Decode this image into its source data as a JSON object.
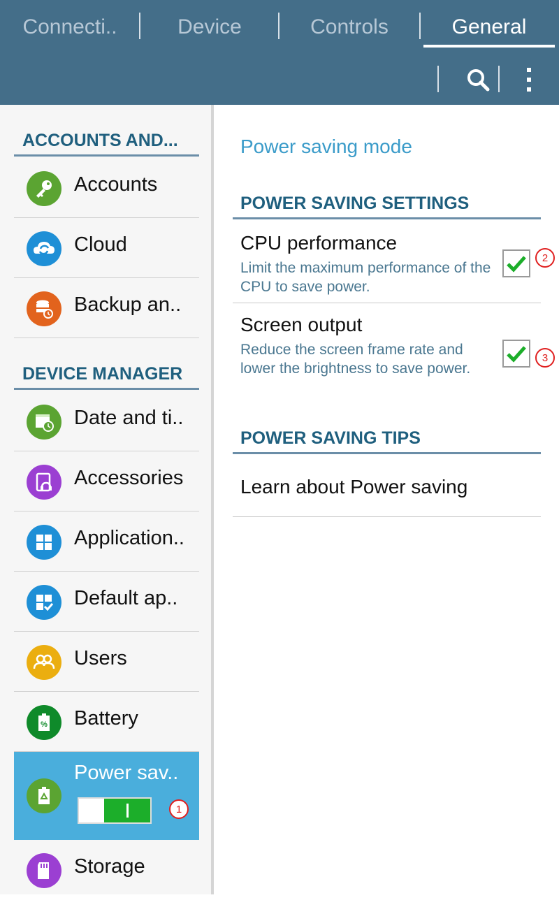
{
  "tabs": [
    {
      "label": "Connecti.."
    },
    {
      "label": "Device"
    },
    {
      "label": "Controls"
    },
    {
      "label": "General"
    }
  ],
  "active_tab": "General",
  "toolbar": {
    "search_icon": "search-icon",
    "more_icon": "more-vert-icon"
  },
  "sidebar": {
    "sections": [
      {
        "title": "ACCOUNTS AND..."
      },
      {
        "title": "DEVICE MANAGER"
      }
    ],
    "items": [
      {
        "label": "Accounts",
        "icon": "key-icon",
        "color": "#5ba432"
      },
      {
        "label": "Cloud",
        "icon": "cloud-sync-icon",
        "color": "#1e8fd6"
      },
      {
        "label": "Backup an..",
        "icon": "backup-icon",
        "color": "#e2631d"
      },
      {
        "label": "Date and ti..",
        "icon": "calendar-clock-icon",
        "color": "#5ba432"
      },
      {
        "label": "Accessories",
        "icon": "accessories-icon",
        "color": "#9b3fd2"
      },
      {
        "label": "Application..",
        "icon": "apps-grid-icon",
        "color": "#1e8fd6"
      },
      {
        "label": "Default ap..",
        "icon": "default-apps-icon",
        "color": "#1e8fd6"
      },
      {
        "label": "Users",
        "icon": "users-icon",
        "color": "#ebae10"
      },
      {
        "label": "Battery",
        "icon": "battery-icon",
        "color": "#0f8a2a"
      },
      {
        "label": "Power sav..",
        "icon": "power-saving-icon",
        "color": "#5ba432"
      },
      {
        "label": "Storage",
        "icon": "sd-card-icon",
        "color": "#9b3fd2"
      }
    ],
    "power_saving_toggle": "on"
  },
  "badges": {
    "one": "1",
    "two": "2",
    "three": "3"
  },
  "main": {
    "title": "Power saving mode",
    "settings_header": "POWER SAVING SETTINGS",
    "cpu": {
      "title": "CPU performance",
      "summary": "Limit the maximum performance of the CPU to save power.",
      "checked": true
    },
    "screen": {
      "title": "Screen output",
      "summary": "Reduce the screen frame rate and lower the brightness to save power.",
      "checked": true
    },
    "tips_header": "POWER SAVING TIPS",
    "learn": "Learn about Power saving"
  },
  "colors": {
    "topbar": "#446e89",
    "accent": "#4aaedc",
    "header_text": "#1f5f7e",
    "check": "#1cae2a"
  }
}
